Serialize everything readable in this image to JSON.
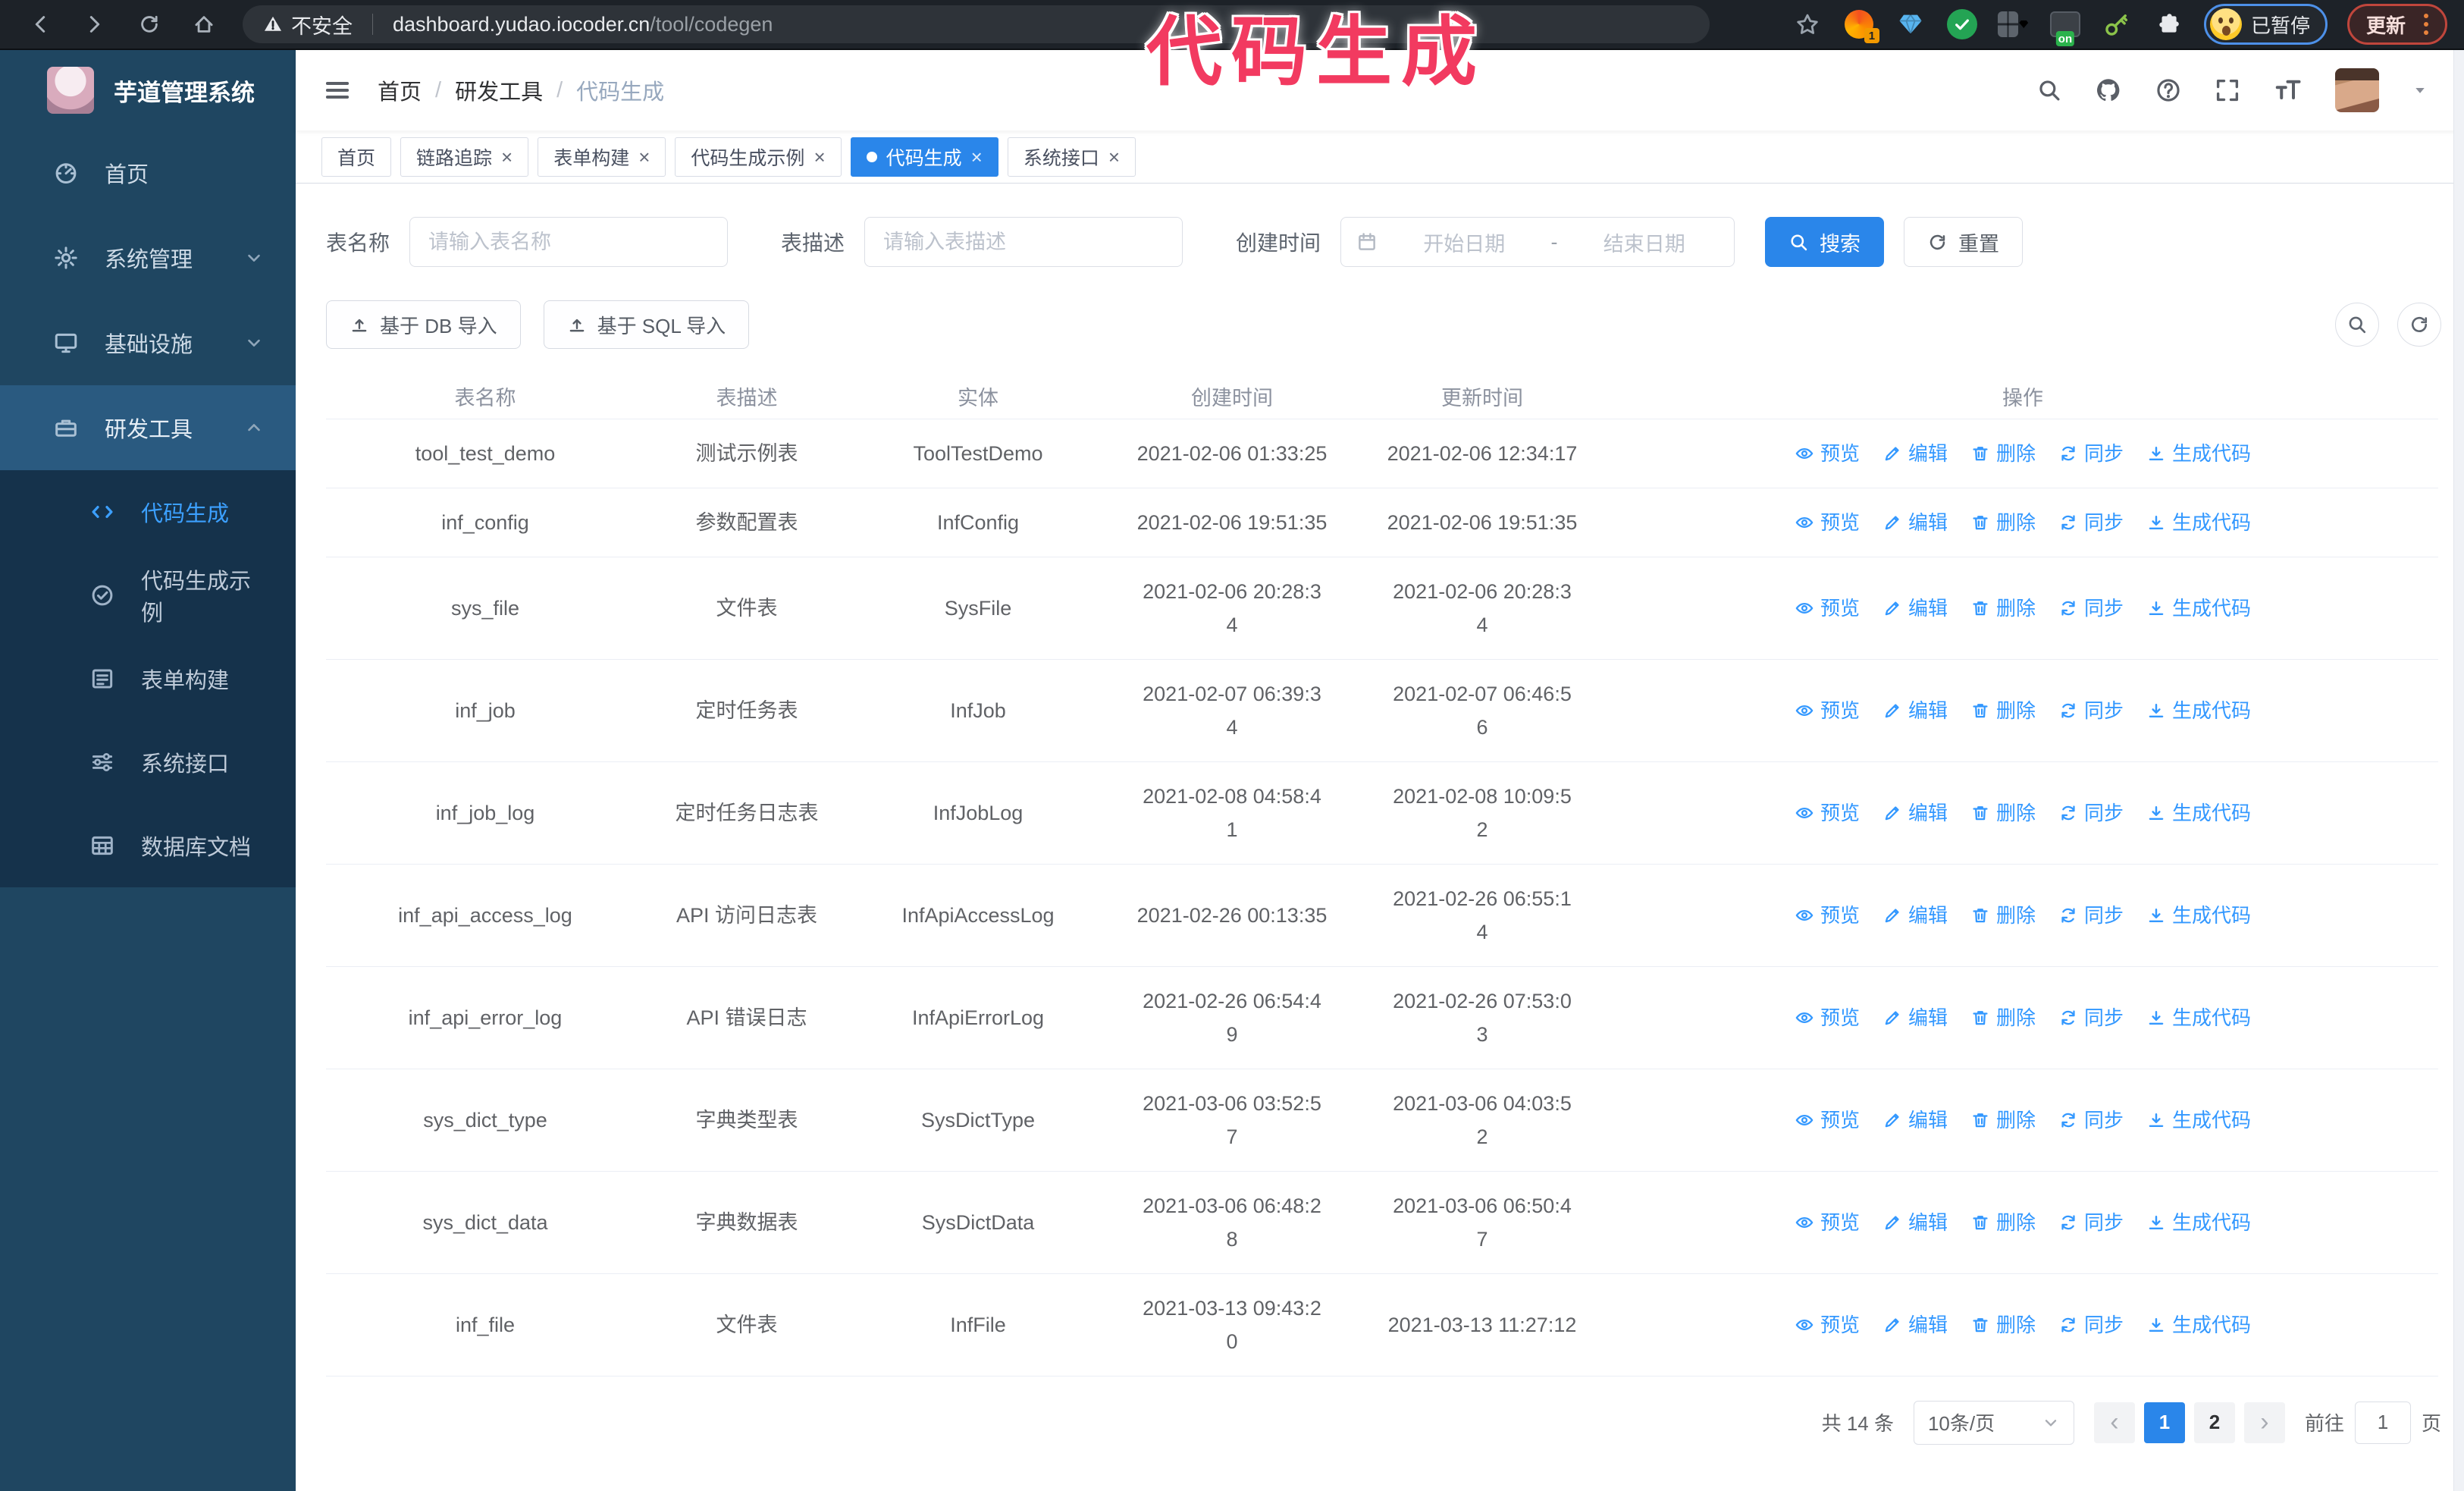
{
  "browser": {
    "security_label": "不安全",
    "url_host": "dashboard.yudao.iocoder.cn",
    "url_path": "/tool/codegen",
    "ext_badge_1": "1",
    "ext_badge_on": "on",
    "profile_status": "已暂停",
    "update_label": "更新"
  },
  "annotation": {
    "text": "代码生成"
  },
  "colors": {
    "accent": "#2a86ea",
    "link": "#3398ff",
    "sidebar_bg": "#1f4661",
    "submenu_bg": "#15324b",
    "annotation": "#f23a60"
  },
  "sidebar": {
    "logo_title": "芋道管理系统",
    "items": [
      {
        "key": "home",
        "label": "首页",
        "icon": "dashboard-icon"
      },
      {
        "key": "system",
        "label": "系统管理",
        "icon": "gear-icon",
        "chevron": "down"
      },
      {
        "key": "infra",
        "label": "基础设施",
        "icon": "monitor-icon",
        "chevron": "down"
      },
      {
        "key": "devtools",
        "label": "研发工具",
        "icon": "toolbox-icon",
        "chevron": "up",
        "active": true
      }
    ],
    "subitems": [
      {
        "key": "codegen",
        "label": "代码生成",
        "icon": "code-icon",
        "active": true
      },
      {
        "key": "codegen-example",
        "label": "代码生成示例",
        "icon": "example-icon"
      },
      {
        "key": "form-build",
        "label": "表单构建",
        "icon": "form-icon"
      },
      {
        "key": "system-api",
        "label": "系统接口",
        "icon": "api-icon"
      },
      {
        "key": "db-doc",
        "label": "数据库文档",
        "icon": "database-doc-icon"
      }
    ]
  },
  "header": {
    "breadcrumb": [
      "首页",
      "研发工具",
      "代码生成"
    ]
  },
  "tabs": [
    {
      "label": "首页",
      "closable": false,
      "active": false
    },
    {
      "label": "链路追踪",
      "closable": true,
      "active": false
    },
    {
      "label": "表单构建",
      "closable": true,
      "active": false
    },
    {
      "label": "代码生成示例",
      "closable": true,
      "active": false
    },
    {
      "label": "代码生成",
      "closable": true,
      "active": true
    },
    {
      "label": "系统接口",
      "closable": true,
      "active": false
    }
  ],
  "search_form": {
    "name_label": "表名称",
    "name_placeholder": "请输入表名称",
    "desc_label": "表描述",
    "desc_placeholder": "请输入表描述",
    "time_label": "创建时间",
    "start_placeholder": "开始日期",
    "range_separator": "-",
    "end_placeholder": "结束日期",
    "search_label": "搜索",
    "reset_label": "重置"
  },
  "toolbar": {
    "db_import_label": "基于 DB 导入",
    "sql_import_label": "基于 SQL 导入"
  },
  "table": {
    "columns": [
      "表名称",
      "表描述",
      "实体",
      "创建时间",
      "更新时间",
      "操作"
    ],
    "actions": [
      "预览",
      "编辑",
      "删除",
      "同步",
      "生成代码"
    ],
    "rows": [
      {
        "name": "tool_test_demo",
        "desc": "测试示例表",
        "entity": "ToolTestDemo",
        "created": "2021-02-06 01:33:25",
        "updated": "2021-02-06 12:34:17"
      },
      {
        "name": "inf_config",
        "desc": "参数配置表",
        "entity": "InfConfig",
        "created": "2021-02-06 19:51:35",
        "updated": "2021-02-06 19:51:35"
      },
      {
        "name": "sys_file",
        "desc": "文件表",
        "entity": "SysFile",
        "created": "2021-02-06 20:28:3\n4",
        "updated": "2021-02-06 20:28:3\n4"
      },
      {
        "name": "inf_job",
        "desc": "定时任务表",
        "entity": "InfJob",
        "created": "2021-02-07 06:39:3\n4",
        "updated": "2021-02-07 06:46:5\n6"
      },
      {
        "name": "inf_job_log",
        "desc": "定时任务日志表",
        "entity": "InfJobLog",
        "created": "2021-02-08 04:58:4\n1",
        "updated": "2021-02-08 10:09:5\n2"
      },
      {
        "name": "inf_api_access_log",
        "desc": "API 访问日志表",
        "entity": "InfApiAccessLog",
        "created": "2021-02-26 00:13:35",
        "updated": "2021-02-26 06:55:1\n4"
      },
      {
        "name": "inf_api_error_log",
        "desc": "API 错误日志",
        "entity": "InfApiErrorLog",
        "created": "2021-02-26 06:54:4\n9",
        "updated": "2021-02-26 07:53:0\n3"
      },
      {
        "name": "sys_dict_type",
        "desc": "字典类型表",
        "entity": "SysDictType",
        "created": "2021-03-06 03:52:5\n7",
        "updated": "2021-03-06 04:03:5\n2"
      },
      {
        "name": "sys_dict_data",
        "desc": "字典数据表",
        "entity": "SysDictData",
        "created": "2021-03-06 06:48:2\n8",
        "updated": "2021-03-06 06:50:4\n7"
      },
      {
        "name": "inf_file",
        "desc": "文件表",
        "entity": "InfFile",
        "created": "2021-03-13 09:43:2\n0",
        "updated": "2021-03-13 11:27:12"
      }
    ]
  },
  "pagination": {
    "total": "共 14 条",
    "page_size": "10条/页",
    "pages": [
      "1",
      "2"
    ],
    "active_page": "1",
    "prev": "‹",
    "next": "›",
    "goto_label": "前往",
    "goto_value": "1",
    "goto_suffix": "页"
  }
}
